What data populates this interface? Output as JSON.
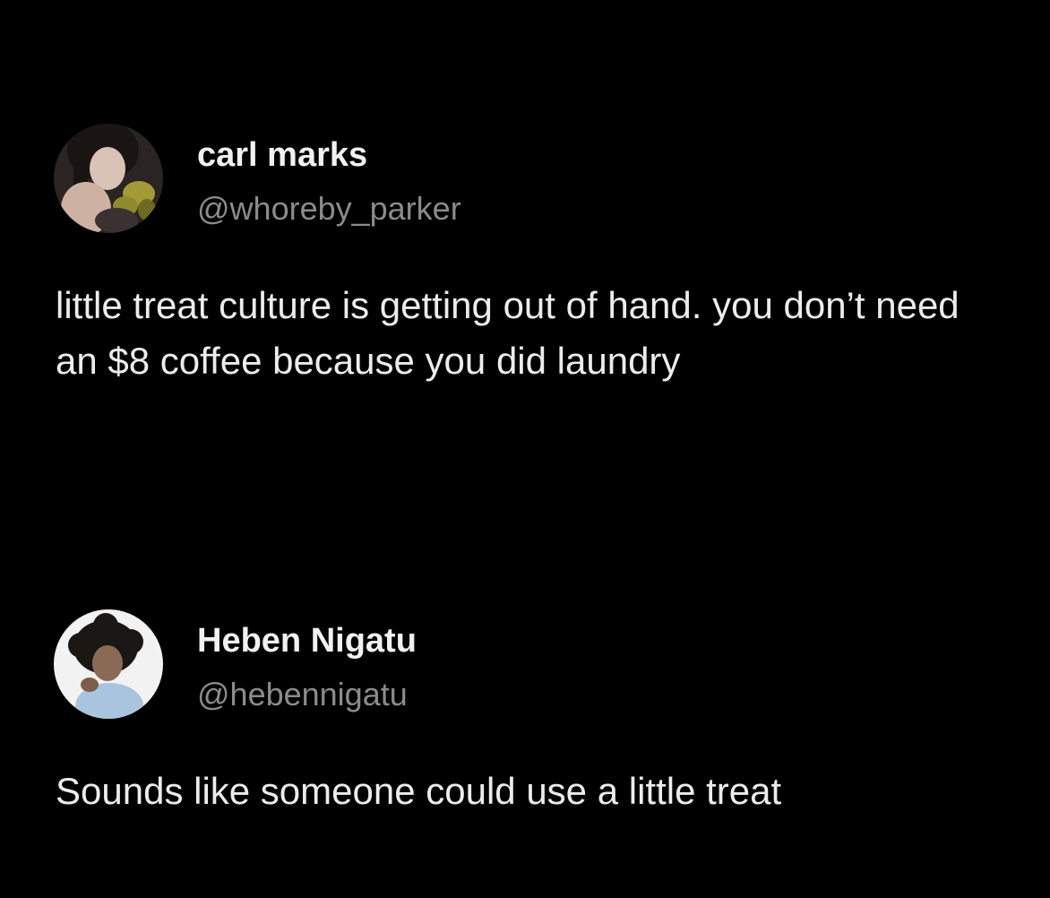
{
  "tweets": [
    {
      "display_name": "carl marks",
      "handle": "@whoreby_parker",
      "text": "little treat culture is getting out of hand. you don’t need an $8 coffee because you did laundry",
      "avatar_icon": "profile-photo-woman-with-flowers"
    },
    {
      "display_name": "Heben Nigatu",
      "handle": "@hebennigatu",
      "text": "Sounds like someone could use a little treat",
      "avatar_icon": "profile-photo-person-curly-hair"
    }
  ],
  "colors": {
    "background": "#000000",
    "name": "#f1f1f1",
    "handle": "#8b8b8b",
    "text": "#ececec"
  }
}
